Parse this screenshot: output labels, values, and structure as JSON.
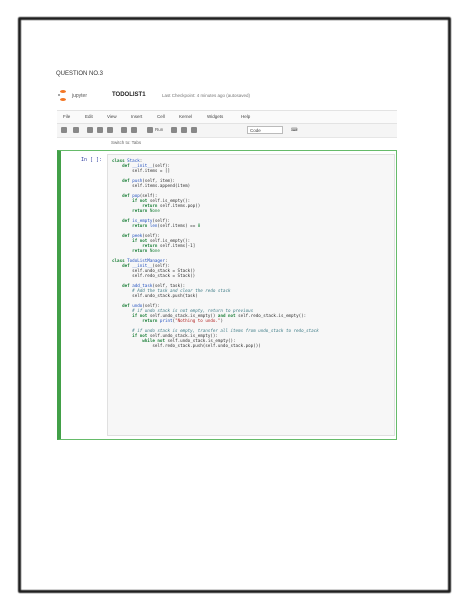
{
  "question_title": "QUESTION NO.3",
  "notebook": {
    "brand": "jupyter",
    "name": "TODOLIST1",
    "checkpoint": "Last Checkpoint: 4 minutes ago (autosaved)"
  },
  "menu": [
    "File",
    "Edit",
    "View",
    "Insert",
    "Cell",
    "Kernel",
    "Widgets",
    "Help"
  ],
  "toolbar": {
    "run_label": "Run",
    "cell_type": "Code",
    "extra": "⌨"
  },
  "command_hint": "Switch to: Tabs",
  "cell": {
    "prompt": "In [ ]:"
  },
  "code_lines": [
    [
      [
        "k",
        "class "
      ],
      [
        "f",
        "Stack"
      ],
      [
        "t",
        ":"
      ]
    ],
    [
      [
        "t",
        "    "
      ],
      [
        "k",
        "def "
      ],
      [
        "f",
        "__init__"
      ],
      [
        "t",
        "(self):"
      ]
    ],
    [
      [
        "t",
        "        self.items = []"
      ]
    ],
    [
      [
        "t",
        ""
      ]
    ],
    [
      [
        "t",
        "    "
      ],
      [
        "k",
        "def "
      ],
      [
        "f",
        "push"
      ],
      [
        "t",
        "(self, item):"
      ]
    ],
    [
      [
        "t",
        "        self.items.append(item)"
      ]
    ],
    [
      [
        "t",
        ""
      ]
    ],
    [
      [
        "t",
        "    "
      ],
      [
        "k",
        "def "
      ],
      [
        "f",
        "pop"
      ],
      [
        "t",
        "(self):"
      ]
    ],
    [
      [
        "t",
        "        "
      ],
      [
        "k",
        "if "
      ],
      [
        "k",
        "not "
      ],
      [
        "t",
        "self.is_empty():"
      ]
    ],
    [
      [
        "t",
        "            "
      ],
      [
        "k",
        "return "
      ],
      [
        "t",
        "self.items.pop()"
      ]
    ],
    [
      [
        "t",
        "        "
      ],
      [
        "k",
        "return "
      ],
      [
        "n",
        "None"
      ]
    ],
    [
      [
        "t",
        ""
      ]
    ],
    [
      [
        "t",
        "    "
      ],
      [
        "k",
        "def "
      ],
      [
        "f",
        "is_empty"
      ],
      [
        "t",
        "(self):"
      ]
    ],
    [
      [
        "t",
        "        "
      ],
      [
        "k",
        "return "
      ],
      [
        "f",
        "len"
      ],
      [
        "t",
        "(self.items) == "
      ],
      [
        "n",
        "0"
      ]
    ],
    [
      [
        "t",
        ""
      ]
    ],
    [
      [
        "t",
        "    "
      ],
      [
        "k",
        "def "
      ],
      [
        "f",
        "peek"
      ],
      [
        "t",
        "(self):"
      ]
    ],
    [
      [
        "t",
        "        "
      ],
      [
        "k",
        "if "
      ],
      [
        "k",
        "not "
      ],
      [
        "t",
        "self.is_empty():"
      ]
    ],
    [
      [
        "t",
        "            "
      ],
      [
        "k",
        "return "
      ],
      [
        "t",
        "self.items[-1]"
      ]
    ],
    [
      [
        "t",
        "        "
      ],
      [
        "k",
        "return "
      ],
      [
        "n",
        "None"
      ]
    ],
    [
      [
        "t",
        ""
      ]
    ],
    [
      [
        "k",
        "class "
      ],
      [
        "f",
        "TodoListManager"
      ],
      [
        "t",
        ":"
      ]
    ],
    [
      [
        "t",
        "    "
      ],
      [
        "k",
        "def "
      ],
      [
        "f",
        "__init__"
      ],
      [
        "t",
        "(self):"
      ]
    ],
    [
      [
        "t",
        "        self.undo_stack = Stack()"
      ]
    ],
    [
      [
        "t",
        "        self.redo_stack = Stack()"
      ]
    ],
    [
      [
        "t",
        ""
      ]
    ],
    [
      [
        "t",
        "    "
      ],
      [
        "k",
        "def "
      ],
      [
        "f",
        "add_task"
      ],
      [
        "t",
        "(self, task):"
      ]
    ],
    [
      [
        "c",
        "        # Add the task and clear the redo stack"
      ]
    ],
    [
      [
        "t",
        "        self.undo_stack.push(task)"
      ]
    ],
    [
      [
        "t",
        ""
      ]
    ],
    [
      [
        "t",
        "    "
      ],
      [
        "k",
        "def "
      ],
      [
        "f",
        "undo"
      ],
      [
        "t",
        "(self):"
      ]
    ],
    [
      [
        "c",
        "        # if undo stack is not empty, return to previous"
      ]
    ],
    [
      [
        "t",
        "        "
      ],
      [
        "k",
        "if "
      ],
      [
        "k",
        "not "
      ],
      [
        "t",
        "self.undo_stack.is_empty() "
      ],
      [
        "k",
        "and not "
      ],
      [
        "t",
        "self.redo_stack.is_empty():"
      ]
    ],
    [
      [
        "t",
        "            "
      ],
      [
        "k",
        "return "
      ],
      [
        "f",
        "print"
      ],
      [
        "t",
        "("
      ],
      [
        "s",
        "\"Nothing to undo.\""
      ],
      [
        "t",
        ")"
      ]
    ],
    [
      [
        "t",
        ""
      ]
    ],
    [
      [
        "c",
        "        # if undo stack is empty, transfer all items from undo_stack to redo_stack"
      ]
    ],
    [
      [
        "t",
        "        "
      ],
      [
        "k",
        "if "
      ],
      [
        "k",
        "not "
      ],
      [
        "t",
        "self.undo_stack.is_empty():"
      ]
    ],
    [
      [
        "t",
        "            "
      ],
      [
        "k",
        "while "
      ],
      [
        "k",
        "not "
      ],
      [
        "t",
        "self.undo_stack.is_empty():"
      ]
    ],
    [
      [
        "t",
        "                self.redo_stack.push(self.undo_stack.pop())"
      ]
    ]
  ],
  "colors": {
    "cell_border": "#42a048",
    "logo": "#f37726"
  }
}
